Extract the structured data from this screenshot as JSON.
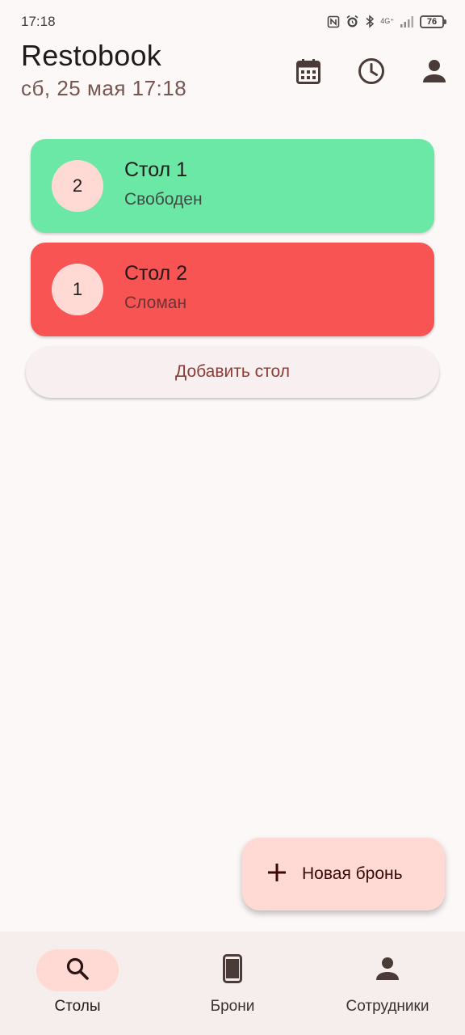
{
  "status_bar": {
    "time": "17:18",
    "network": "4G⁺",
    "battery": "76",
    "icons": [
      "nfc-icon",
      "alarm-icon",
      "bluetooth-icon",
      "signal-icon",
      "battery-icon"
    ]
  },
  "header": {
    "title": "Restobook",
    "date": "сб, 25 мая 17:18",
    "actions": [
      "calendar-icon",
      "clock-icon",
      "person-icon"
    ]
  },
  "tables": [
    {
      "seats": "2",
      "name": "Стол 1",
      "status": "Свободен",
      "color": "#6ce8a6"
    },
    {
      "seats": "1",
      "name": "Стол 2",
      "status": "Сломан",
      "color": "#f95454"
    }
  ],
  "add_table_label": "Добавить стол",
  "fab": {
    "label": "Новая бронь",
    "icon": "plus-icon"
  },
  "bottom_nav": {
    "items": [
      {
        "label": "Столы",
        "icon": "search-icon",
        "active": true
      },
      {
        "label": "Брони",
        "icon": "phone-icon",
        "active": false
      },
      {
        "label": "Сотрудники",
        "icon": "person-icon",
        "active": false
      }
    ]
  },
  "colors": {
    "background": "#fdf8f8",
    "accent_container": "#ffdad5",
    "free": "#6ce8a6",
    "broken": "#f95454",
    "primary_text": "#8e3b33"
  }
}
